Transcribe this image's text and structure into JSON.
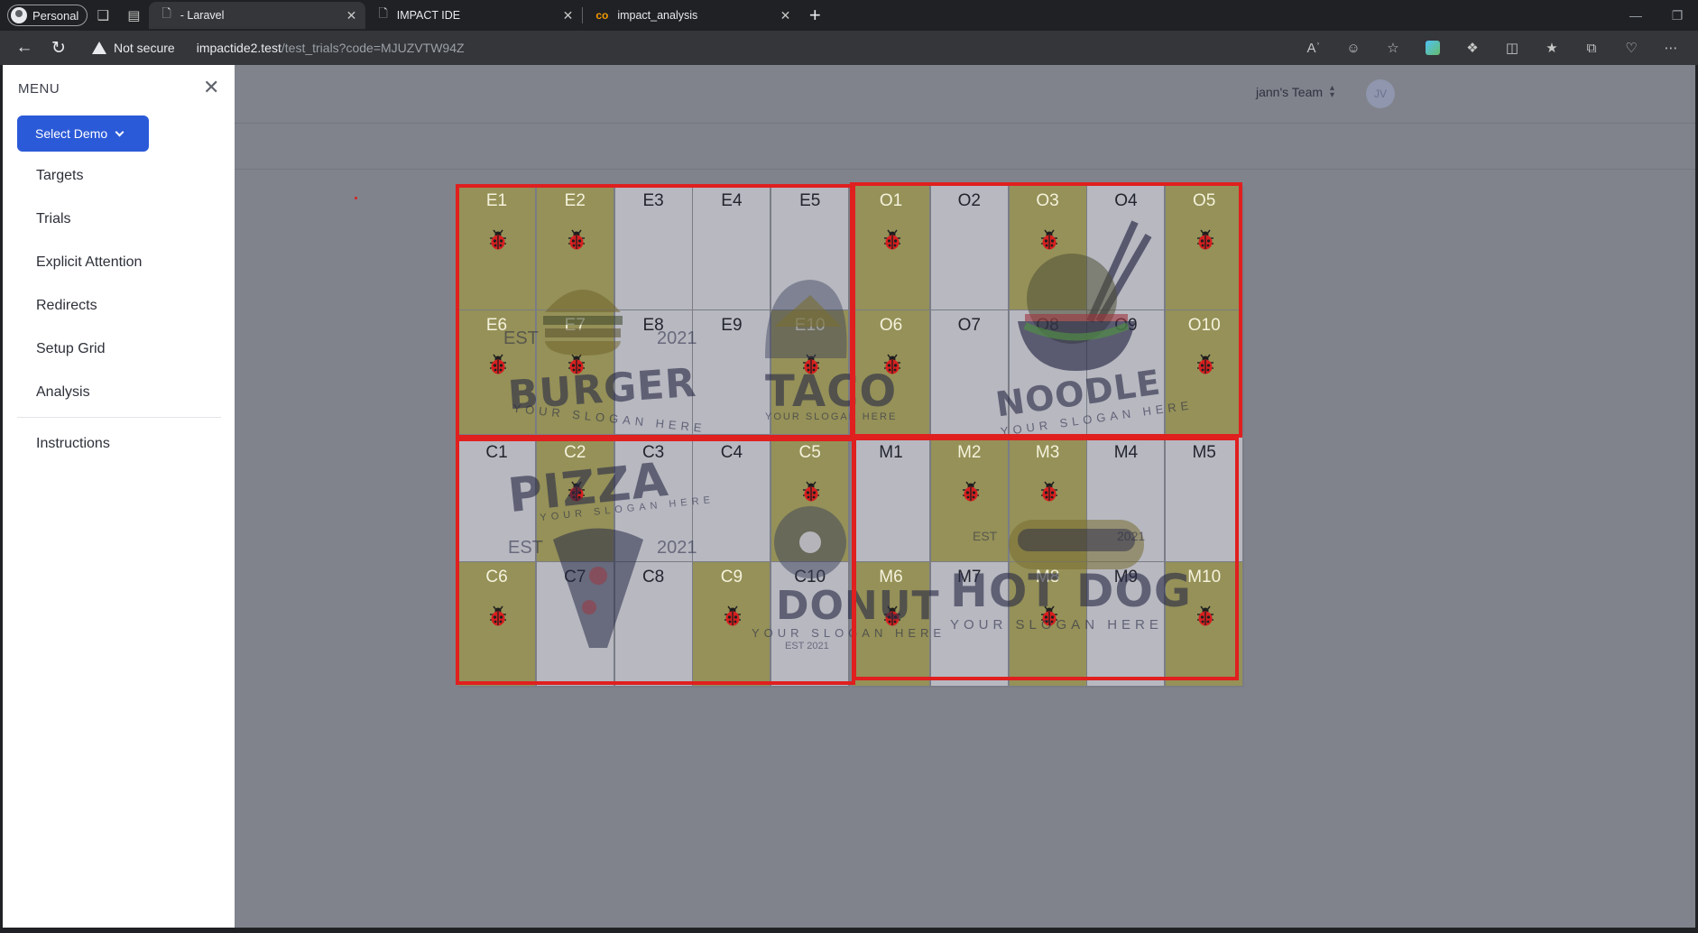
{
  "browser": {
    "profile_label": "Personal",
    "tabs": [
      {
        "title": "- Laravel"
      },
      {
        "title": "IMPACT IDE"
      },
      {
        "title": "impact_analysis"
      }
    ],
    "security_label": "Not secure",
    "url_host": "impactide2.test",
    "url_path": "/test_trials?code=MJUZVTW94Z"
  },
  "header": {
    "team_name": "jann's Team",
    "avatar_initials": "JV"
  },
  "sidebar": {
    "title": "MENU",
    "select_demo_label": "Select Demo",
    "items": [
      {
        "label": "Targets"
      },
      {
        "label": "Trials"
      },
      {
        "label": "Explicit Attention"
      },
      {
        "label": "Redirects"
      },
      {
        "label": "Setup Grid"
      },
      {
        "label": "Analysis"
      }
    ],
    "bottom_items": [
      {
        "label": "Instructions"
      }
    ]
  },
  "grid": {
    "cells": [
      {
        "label": "E1",
        "active": true
      },
      {
        "label": "E2",
        "active": true
      },
      {
        "label": "E3",
        "active": false
      },
      {
        "label": "E4",
        "active": false
      },
      {
        "label": "E5",
        "active": false
      },
      {
        "label": "O1",
        "active": true
      },
      {
        "label": "O2",
        "active": false
      },
      {
        "label": "O3",
        "active": true
      },
      {
        "label": "O4",
        "active": false
      },
      {
        "label": "O5",
        "active": true
      },
      {
        "label": "E6",
        "active": true
      },
      {
        "label": "E7",
        "active": true
      },
      {
        "label": "E8",
        "active": false
      },
      {
        "label": "E9",
        "active": false
      },
      {
        "label": "E10",
        "active": true
      },
      {
        "label": "O6",
        "active": true
      },
      {
        "label": "O7",
        "active": false
      },
      {
        "label": "O8",
        "active": false
      },
      {
        "label": "O9",
        "active": false
      },
      {
        "label": "O10",
        "active": true
      },
      {
        "label": "C1",
        "active": false
      },
      {
        "label": "C2",
        "active": true
      },
      {
        "label": "C3",
        "active": false
      },
      {
        "label": "C4",
        "active": false
      },
      {
        "label": "C5",
        "active": true
      },
      {
        "label": "M1",
        "active": false
      },
      {
        "label": "M2",
        "active": true
      },
      {
        "label": "M3",
        "active": true
      },
      {
        "label": "M4",
        "active": false
      },
      {
        "label": "M5",
        "active": false
      },
      {
        "label": "C6",
        "active": true
      },
      {
        "label": "C7",
        "active": false
      },
      {
        "label": "C8",
        "active": false
      },
      {
        "label": "C9",
        "active": true
      },
      {
        "label": "C10",
        "active": false
      },
      {
        "label": "M6",
        "active": true
      },
      {
        "label": "M7",
        "active": false
      },
      {
        "label": "M8",
        "active": true
      },
      {
        "label": "M9",
        "active": false
      },
      {
        "label": "M10",
        "active": true
      }
    ],
    "logos": {
      "burger": "BURGER",
      "taco": "TACO",
      "noodle": "NOODLE",
      "pizza": "PIZZA",
      "donut": "DONUT",
      "hotdog": "HOT DOG",
      "slogan": "YOUR SLOGAN HERE",
      "est": "EST",
      "year": "2021",
      "est_year": "EST 2021"
    },
    "accent_color": "#e01f1f",
    "active_cell_color": "#96915a",
    "inactive_cell_color": "#bcbdc4"
  },
  "icons": {
    "target_marker": "ladybug-icon"
  }
}
